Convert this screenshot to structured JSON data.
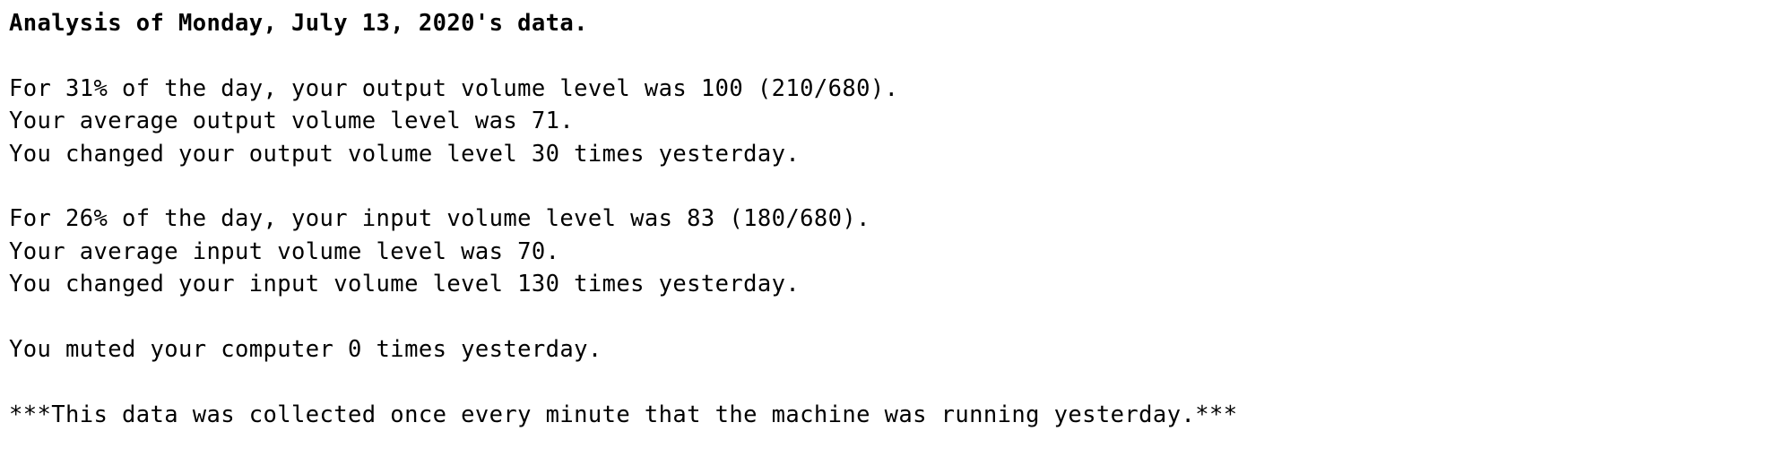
{
  "report": {
    "title": "Analysis of Monday, July 13, 2020's data.",
    "output": {
      "peak_line": "For 31% of the day, your output volume level was 100 (210/680).",
      "average_line": "Your average output volume level was 71.",
      "changes_line": "You changed your output volume level 30 times yesterday."
    },
    "input": {
      "peak_line": "For 26% of the day, your input volume level was 83 (180/680).",
      "average_line": "Your average input volume level was 70.",
      "changes_line": "You changed your input volume level 130 times yesterday."
    },
    "mute_line": "You muted your computer 0 times yesterday.",
    "footnote": "***This data was collected once every minute that the machine was running yesterday.***"
  }
}
